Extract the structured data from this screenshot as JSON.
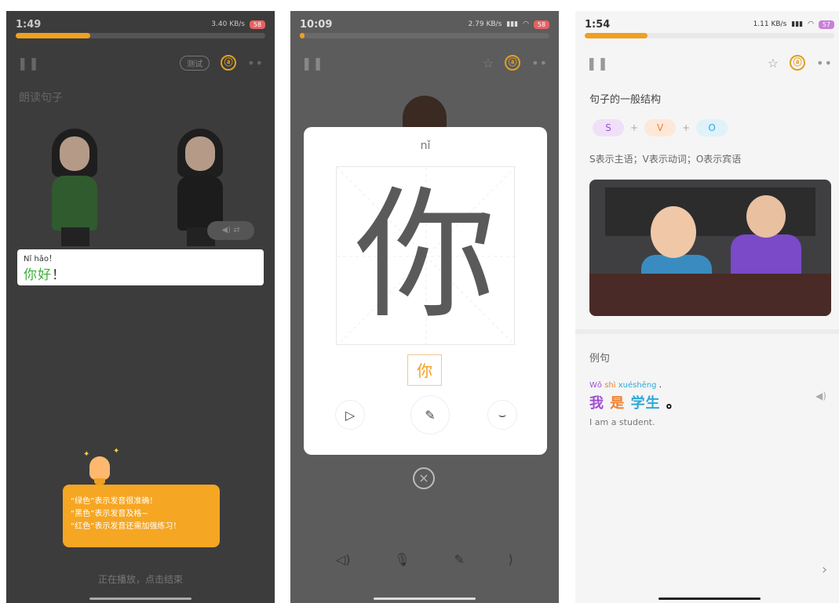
{
  "phone1": {
    "status": {
      "time": "1:49",
      "net": "3.40 KB/s",
      "battery": "58"
    },
    "progress": 0.3,
    "test_label": "测试",
    "coin_symbol": "ⓐ",
    "section_title": "朗读句子",
    "sentence": {
      "pinyin": "Nǐ hǎo！",
      "hanzi_green": "你好",
      "punct": "！"
    },
    "tips": [
      "“绿色”表示发音很准确！",
      "“黑色”表示发音及格~",
      "“红色”表示发音还需加强练习！"
    ],
    "bottom_hint": "正在播放，点击结束"
  },
  "phone2": {
    "status": {
      "time": "10:09",
      "net": "2.79 KB/s",
      "battery": "58"
    },
    "progress": 0.02,
    "coin_symbol": "ⓐ",
    "char_pinyin": "nǐ",
    "char": "你",
    "small_char": "你"
  },
  "phone3": {
    "status": {
      "time": "1:54",
      "net": "1.11 KB/s",
      "battery": "57"
    },
    "progress": 0.25,
    "coin_symbol": "ⓐ",
    "title": "句子的一般结构",
    "svo": [
      "S",
      "V",
      "O"
    ],
    "plus": "+",
    "svo_desc": "S表示主语；V表示动词；O表示宾语",
    "example_title": "例句",
    "example": {
      "pinyin": [
        "Wǒ",
        "shì",
        "xuéshēng",
        "."
      ],
      "hanzi": [
        "我",
        "是",
        "学生",
        "。"
      ],
      "english": "I am a student."
    },
    "colors": {
      "S": "#a050d0",
      "V": "#f08030",
      "O": "#30a8d8"
    }
  }
}
